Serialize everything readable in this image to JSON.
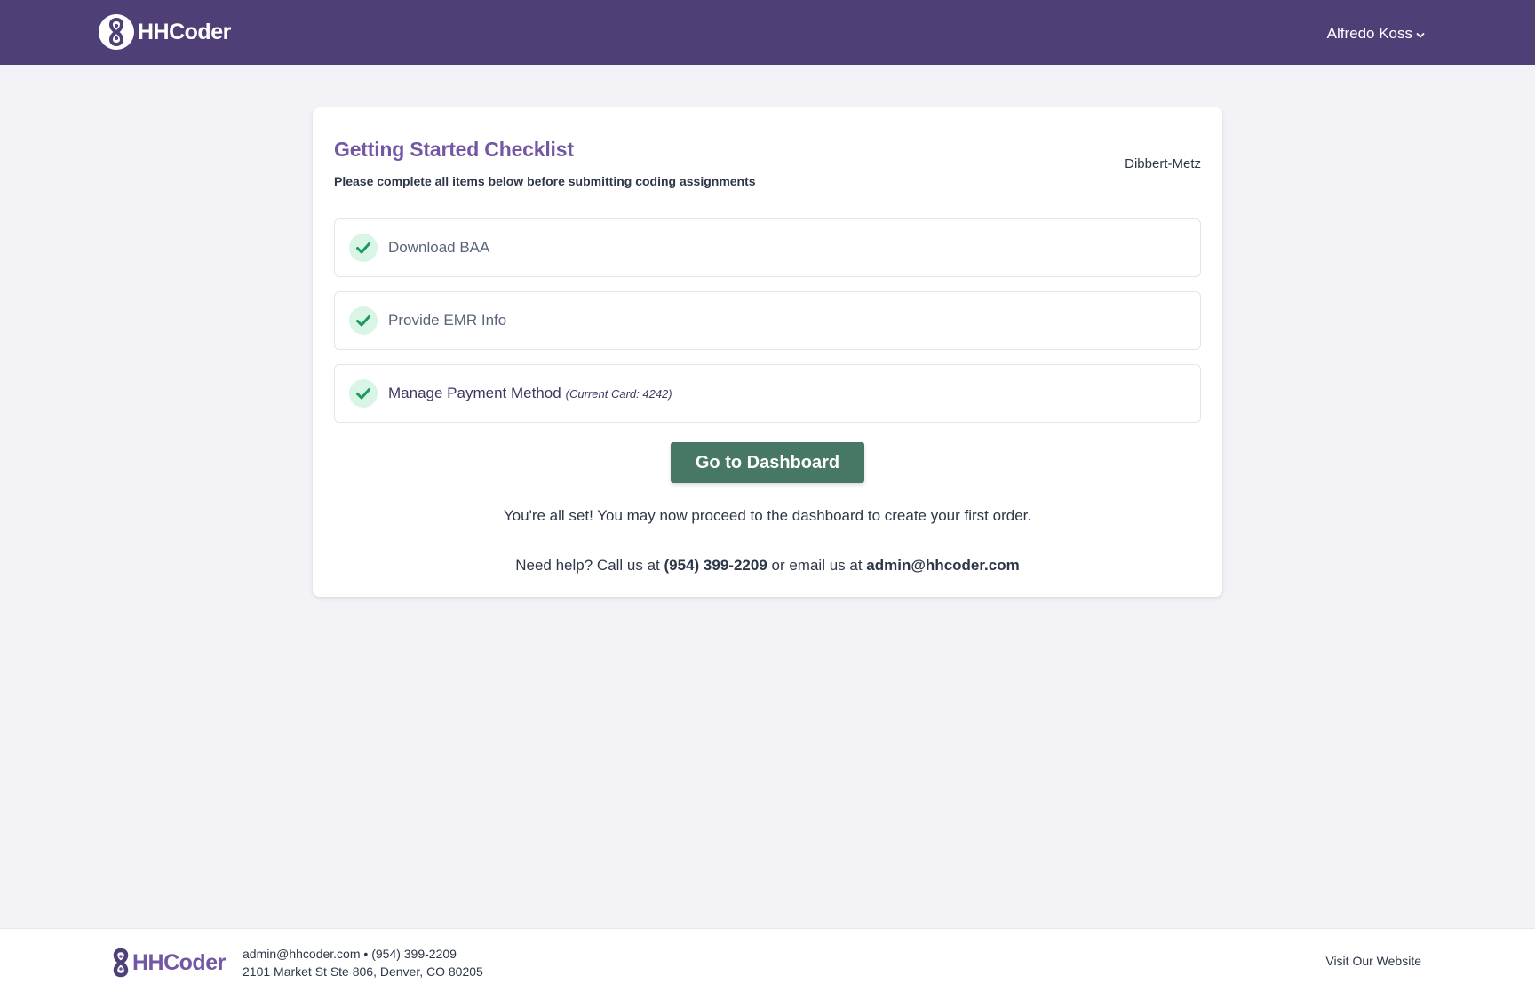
{
  "header": {
    "brand": "HHCoder",
    "user_name": "Alfredo Koss"
  },
  "checklist": {
    "title": "Getting Started Checklist",
    "subtitle": "Please complete all items below before submitting coding assignments",
    "organization": "Dibbert-Metz",
    "items": [
      {
        "label": "Download BAA",
        "completed": true
      },
      {
        "label": "Provide EMR Info",
        "completed": true
      },
      {
        "label": "Manage Payment Method",
        "note": "(Current Card: 4242)",
        "completed": true
      }
    ],
    "button_label": "Go to Dashboard",
    "done_message": "You're all set! You may now proceed to the dashboard to create your first order.",
    "help": {
      "prefix": "Need help? Call us at",
      "phone": "(954) 399-2209",
      "middle": "or email us at",
      "email": "admin@hhcoder.com"
    }
  },
  "footer": {
    "brand": "HHCoder",
    "email": "admin@hhcoder.com",
    "separator": "•",
    "phone": "(954) 399-2209",
    "address": "2101 Market St Ste 806, Denver, CO 80205",
    "link_label": "Visit Our Website"
  },
  "colors": {
    "header_bg": "#4e4076",
    "accent_purple": "#7257a5",
    "button_green": "#477765",
    "check_bg": "#d9f5e6",
    "check_mark": "#1a9a5c",
    "page_bg": "#f3f2f7"
  },
  "icons": {
    "logo": "hhcoder-logo-icon",
    "user_menu": "chevron-down-icon",
    "item_status": "check-circle-icon"
  }
}
